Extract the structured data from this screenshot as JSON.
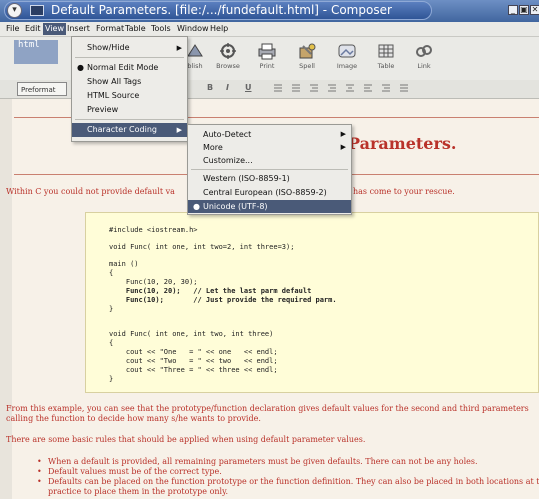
{
  "window": {
    "title": "Default Parameters. [file:/.../fundefault.html] - Composer",
    "controls": [
      "_",
      "▣",
      "✕"
    ]
  },
  "menubar": {
    "items": [
      "File",
      "Edit",
      "View",
      "Insert",
      "Format",
      "Table",
      "Tools",
      "Window",
      "Help"
    ],
    "active": "View"
  },
  "toolbar": {
    "html_badge": "html",
    "buttons": [
      "blish",
      "Browse",
      "Print",
      "Spell",
      "Image",
      "Table",
      "Link"
    ]
  },
  "format_toolbar": {
    "paragraph_format": "Preformat",
    "buttons": [
      "B",
      "I",
      "U"
    ]
  },
  "view_menu": {
    "items": [
      "Show/Hide",
      "Normal Edit Mode",
      "Show All Tags",
      "HTML Source",
      "Preview",
      "Character Coding"
    ],
    "selected": "Normal Edit Mode",
    "highlighted": "Character Coding"
  },
  "coding_menu": {
    "items": [
      "Auto-Detect",
      "More",
      "Customize...",
      "Western (ISO-8859-1)",
      "Central European (ISO-8859-2)",
      "Unicode (UTF-8)"
    ],
    "selected": "Unicode (UTF-8)"
  },
  "document": {
    "heading_visible": "Parameters.",
    "intro_left": "Within C you could not provide default va",
    "intro_right": "has come to your rescue.",
    "code": [
      "#include <iostream.h>",
      "void Func( int one, int two=2, int three=3);",
      "main ()",
      "{",
      "    Func(10, 20, 30);",
      "    Func(10, 20);   // Let the last parm default",
      "    Func(10);       // Just provide the required parm.",
      "}",
      "void Func( int one, int two, int three)",
      "{",
      "    cout << \"One   = \" << one   << endl;",
      "    cout << \"Two   = \" << two   << endl;",
      "    cout << \"Three = \" << three << endl;",
      "}"
    ],
    "after_code_1": "From this example, you can see that the prototype/function declaration gives default values for the second and third parameters",
    "after_code_2": "calling the function to decide how many s/he wants to provide.",
    "rules_intro": "There are some basic rules that should be applied when using default parameter values.",
    "bullets": [
      "When a default is provided, all remaining parameters must be given defaults. There can not be any holes.",
      "Default values must be of the correct type.",
      "Defaults can be placed on the function prototype or the function definition. They can also be placed in both locations at th",
      "practice to place them in the prototype only."
    ]
  },
  "colors": {
    "text_red": "#b9322a",
    "menu_highlight": "#4a5a78",
    "code_bg": "#fffdd8",
    "page_bg": "#f7f1e8"
  }
}
